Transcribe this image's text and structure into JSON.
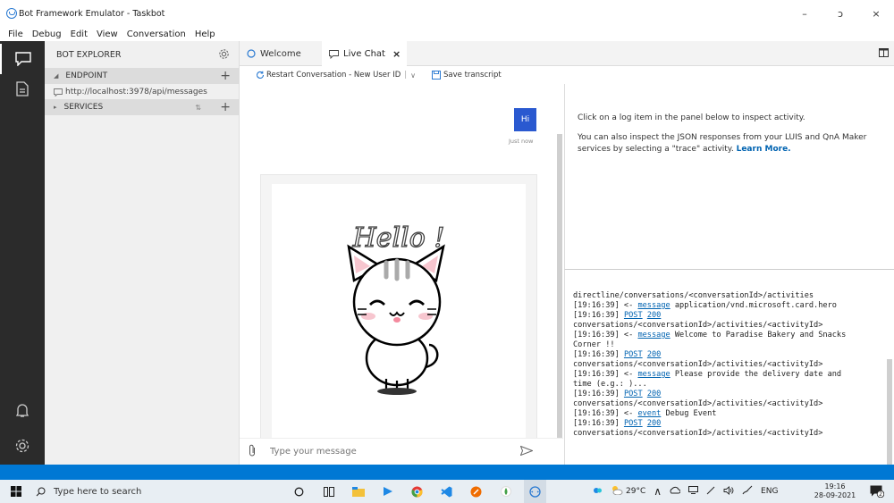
{
  "window": {
    "title": "Bot Framework Emulator - Taskbot",
    "minimize": "–",
    "restore": "ɔ",
    "close": "×"
  },
  "menu": [
    "File",
    "Debug",
    "Edit",
    "View",
    "Conversation",
    "Help"
  ],
  "explorer": {
    "header": "BOT EXPLORER",
    "endpoint_label": "ENDPOINT",
    "endpoint_url": "http://localhost:3978/api/messages",
    "services_label": "SERVICES",
    "add": "+"
  },
  "tabs": {
    "welcome": "Welcome",
    "livechat": "Live Chat",
    "close": "×"
  },
  "toolbar": {
    "restart": "Restart Conversation - New User ID",
    "save": "Save transcript"
  },
  "chat": {
    "user_message": "Hi",
    "timestamp": "Just now",
    "card_text": "Hello !",
    "input_placeholder": "Type your message"
  },
  "inspector": {
    "line1": "Click on a log item in the panel below to inspect activity.",
    "line2": "You can also inspect the JSON responses from your LUIS and QnA Maker services by selecting a \"trace\" activity.",
    "link": "Learn More."
  },
  "log": [
    {
      "text": "directline/conversations/<conversationId>/activities"
    },
    {
      "time": "[19:16:39]",
      "arrow": " <- ",
      "link": "message",
      "rest": " application/vnd.microsoft.card.hero"
    },
    {
      "time": "[19:16:39]",
      "arrow": " ",
      "link": "POST",
      "link2": "200"
    },
    {
      "text": " conversations/<conversationId>/activities/<activityId>"
    },
    {
      "time": "[19:16:39]",
      "arrow": " <- ",
      "link": "message",
      "rest": " Welcome to Paradise Bakery and Snacks"
    },
    {
      "text": "Corner !!"
    },
    {
      "time": "[19:16:39]",
      "arrow": " ",
      "link": "POST",
      "link2": "200"
    },
    {
      "text": " conversations/<conversationId>/activities/<activityId>"
    },
    {
      "time": "[19:16:39]",
      "arrow": " <- ",
      "link": "message",
      "rest": " Please provide the delivery date and"
    },
    {
      "text": "time (e.g.: )..."
    },
    {
      "time": "[19:16:39]",
      "arrow": " ",
      "link": "POST",
      "link2": "200"
    },
    {
      "text": " conversations/<conversationId>/activities/<activityId>"
    },
    {
      "time": "[19:16:39]",
      "arrow": " <- ",
      "link": "event",
      "rest": " Debug Event"
    },
    {
      "time": "[19:16:39]",
      "arrow": " ",
      "link": "POST",
      "link2": "200"
    },
    {
      "text": " conversations/<conversationId>/activities/<activityId>"
    }
  ],
  "taskbar": {
    "search_placeholder": "Type here to search",
    "weather": "29°C",
    "lang": "ENG",
    "time": "19:16",
    "date": "28-09-2021",
    "notifications": "2"
  },
  "colors": {
    "accent": "#0078d4",
    "bubble": "#2a59d0",
    "activity_bar": "#2b2b2b"
  }
}
